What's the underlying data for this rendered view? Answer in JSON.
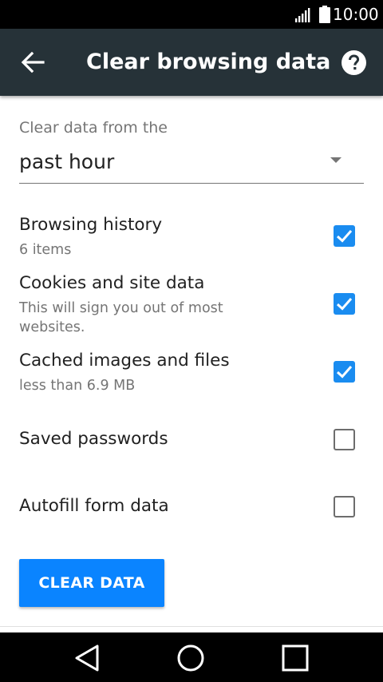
{
  "status_bar": {
    "time": "10:00"
  },
  "app_bar": {
    "title": "Clear browsing data"
  },
  "time_range": {
    "label": "Clear data from the",
    "selected": "past hour"
  },
  "options": [
    {
      "title": "Browsing history",
      "subtitle": "6 items",
      "checked": true
    },
    {
      "title": "Cookies and site data",
      "subtitle": "This will sign you out of most websites.",
      "checked": true
    },
    {
      "title": "Cached images and files",
      "subtitle": "less than 6.9 MB",
      "checked": true
    },
    {
      "title": "Saved passwords",
      "subtitle": "",
      "checked": false
    },
    {
      "title": "Autofill form data",
      "subtitle": "",
      "checked": false
    }
  ],
  "clear_button": {
    "label": "CLEAR DATA"
  },
  "colors": {
    "app_bar": "#263238",
    "accent": "#0a84ff",
    "checkbox": "#1a8cf0"
  },
  "icons": {
    "status": [
      "signal-icon",
      "battery-icon"
    ],
    "app_bar": [
      "back-arrow-icon",
      "help-icon"
    ],
    "nav": [
      "nav-back-icon",
      "nav-home-icon",
      "nav-recents-icon"
    ]
  }
}
